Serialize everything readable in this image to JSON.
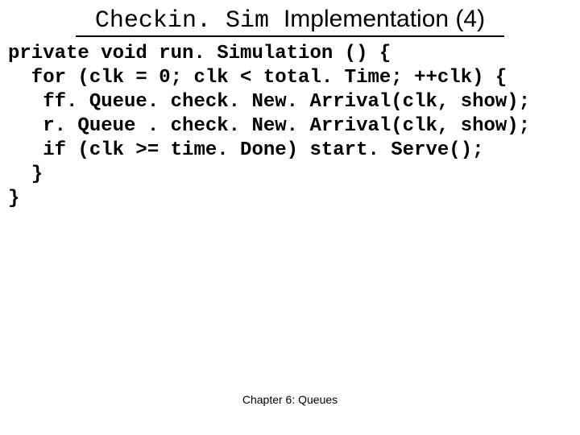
{
  "title": {
    "mono": "Checkin. Sim ",
    "sans": "Implementation (4)"
  },
  "code": {
    "l1": "private void run. Simulation () {",
    "l2": "  for (clk = 0; clk < total. Time; ++clk) {",
    "l3": "   ff. Queue. check. New. Arrival(clk, show);",
    "l4": "   r. Queue . check. New. Arrival(clk, show);",
    "l5": "   if (clk >= time. Done) start. Serve();",
    "l6": "  }",
    "l7": "}"
  },
  "footer": "Chapter 6: Queues"
}
